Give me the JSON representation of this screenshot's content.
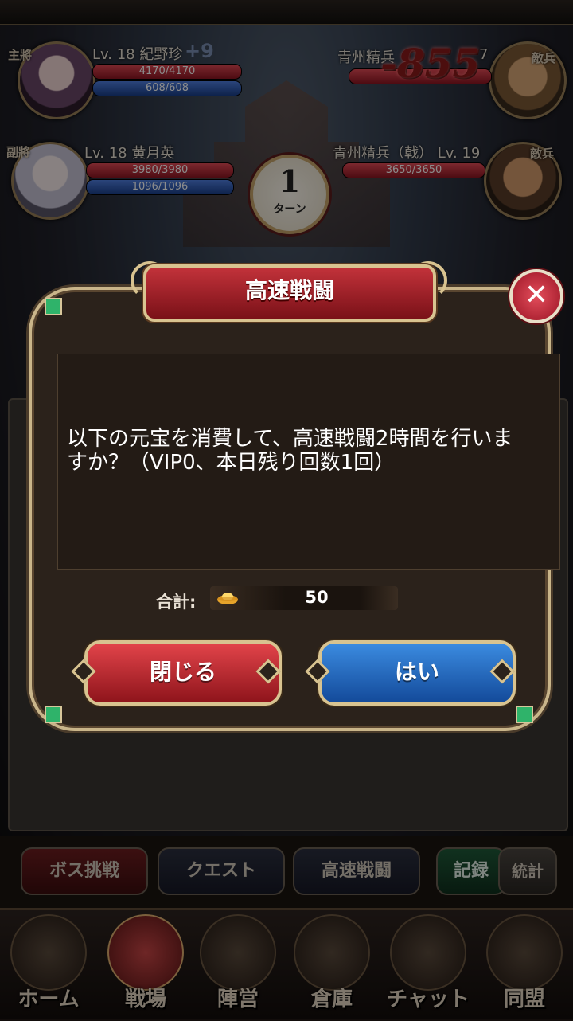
{
  "battle": {
    "ally_main": {
      "role": "主將",
      "level_name": "Lv. 18 紀野珍",
      "hp": "4170/4170",
      "mp": "608/608",
      "bonus": "+9"
    },
    "ally_sub": {
      "role": "副將",
      "level_name": "Lv. 18 黄月英",
      "hp": "3980/3980",
      "mp": "1096/1096"
    },
    "enemy_main": {
      "role": "敵兵",
      "name": "青州精兵",
      "level": "7"
    },
    "enemy_sub": {
      "role": "敵兵",
      "name": "青州精兵（戟） Lv. 19",
      "hp": "3650/3650"
    },
    "damage": "-855",
    "turn": {
      "number": "1",
      "label": "ターン"
    }
  },
  "dialog": {
    "title": "高速戦闘",
    "close_icon_label": "✕",
    "message": "以下の元宝を消費して、高速戦闘2時間を行いますか？（VIP0、本日残り回数1回）",
    "total_label": "合計:",
    "currency_icon": "gold-ingot-icon",
    "total_value": "50",
    "close_button": "閉じる",
    "yes_button": "はい"
  },
  "tabs": [
    "ボス挑戦",
    "クエスト",
    "高速戦闘",
    "記録",
    "統計"
  ],
  "nav": [
    "ホーム",
    "戦場",
    "陣営",
    "倉庫",
    "チャット",
    "同盟"
  ],
  "colors": {
    "accent_red": "#c2323a",
    "accent_blue": "#1f64c0",
    "gold_border": "#d8c390"
  }
}
